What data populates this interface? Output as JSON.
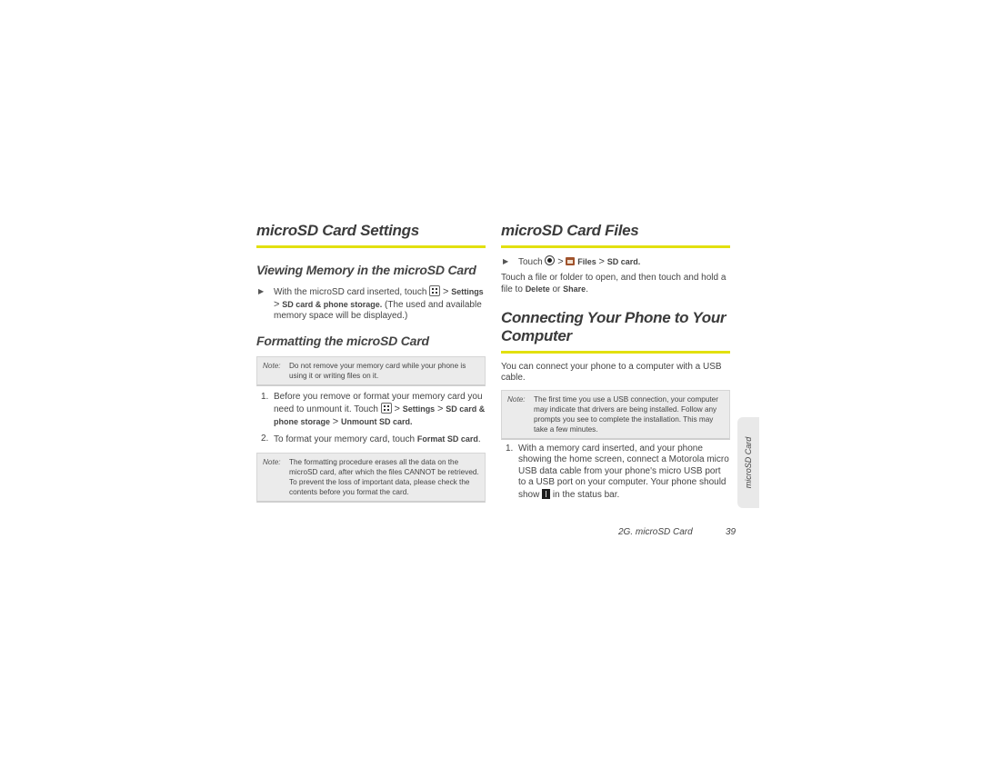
{
  "left": {
    "title": "microSD Card Settings",
    "viewing": {
      "heading": "Viewing Memory in the microSD Card",
      "step_pre": "With the microSD card inserted, touch",
      "step_settings": "Settings",
      "step_storage": "SD card & phone storage.",
      "step_post": "(The used and available memory space will be displayed.)"
    },
    "formatting": {
      "heading": "Formatting the microSD Card",
      "note1_label": "Note:",
      "note1_text": "Do not remove your memory card while your phone is using it or writing files on it.",
      "step1_pre": "Before you remove or format your memory card you need to unmount it. Touch",
      "step1_settings": "Settings",
      "step1_storage": "SD card & phone storage",
      "step1_unmount": "Unmount SD card.",
      "step2_pre": "To format your memory card, touch",
      "step2_format": "Format SD card",
      "note2_label": "Note:",
      "note2_text": "The formatting procedure erases all the data on the microSD card, after which the files CANNOT be retrieved. To prevent the loss of important data, please check the contents before you format the card."
    }
  },
  "right": {
    "files_title": "microSD Card Files",
    "files_step_pre": "Touch",
    "files_step_files": "Files",
    "files_step_sd": "SD card.",
    "files_desc_pre": "Touch a file or folder to open, and then touch and hold a file to",
    "files_delete": "Delete",
    "files_or": "or",
    "files_share": "Share",
    "connect_title": "Connecting Your Phone to Your Computer",
    "connect_desc": "You can connect your phone to a computer with a USB cable.",
    "note_label": "Note:",
    "note_text": "The first time you use a USB connection, your computer may indicate that drivers are being installed. Follow any prompts you see to complete the installation. This may take a few minutes.",
    "step1_pre": "With a memory card inserted, and your phone showing the home screen, connect a Motorola micro USB data cable from your phone's micro USB port to a USB port on your computer. Your phone should show",
    "step1_post": "in the status bar."
  },
  "side_tab": "microSD Card",
  "footer": {
    "section": "2G. microSD Card",
    "page": "39"
  },
  "icons": {
    "arrow": "▶",
    "gt": ">",
    "menu": "menu-key-icon",
    "home": "home-key-icon",
    "files": "files-app-icon",
    "usb": "usb-status-icon"
  },
  "colors": {
    "rule": "#e2e00f",
    "note_bg": "#ebebeb",
    "tab_bg": "#e9e9e9"
  }
}
